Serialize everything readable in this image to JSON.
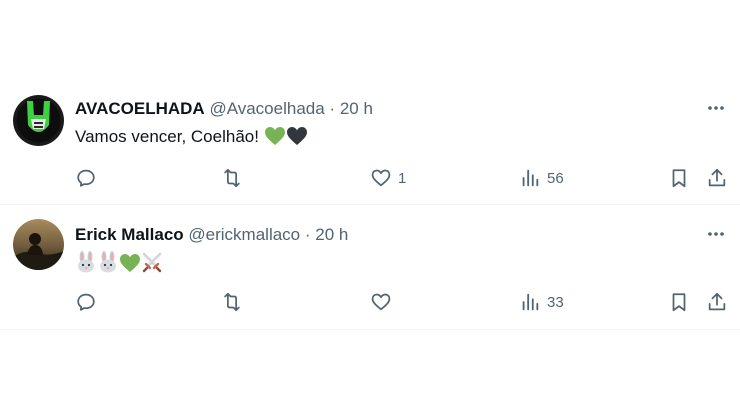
{
  "tweets": [
    {
      "name": "AVACOELHADA",
      "handle": "@Avacoelhada",
      "dot": "·",
      "time": "20 h",
      "text": "Vamos vencer, Coelhão!",
      "emojis": [
        "green-heart",
        "black-heart"
      ],
      "likes": "1",
      "views": "56"
    },
    {
      "name": "Erick Mallaco",
      "handle": "@erickmallaco",
      "dot": "·",
      "time": "20 h",
      "text": "",
      "emojis": [
        "rabbit-face",
        "rabbit-face",
        "green-heart",
        "crossed-swords"
      ],
      "likes": "",
      "views": "33"
    }
  ],
  "colors": {
    "text_primary": "#0f1419",
    "text_secondary": "#536471",
    "separator": "#eff3f4",
    "green_heart": "#77b255",
    "black_heart": "#31373d"
  }
}
